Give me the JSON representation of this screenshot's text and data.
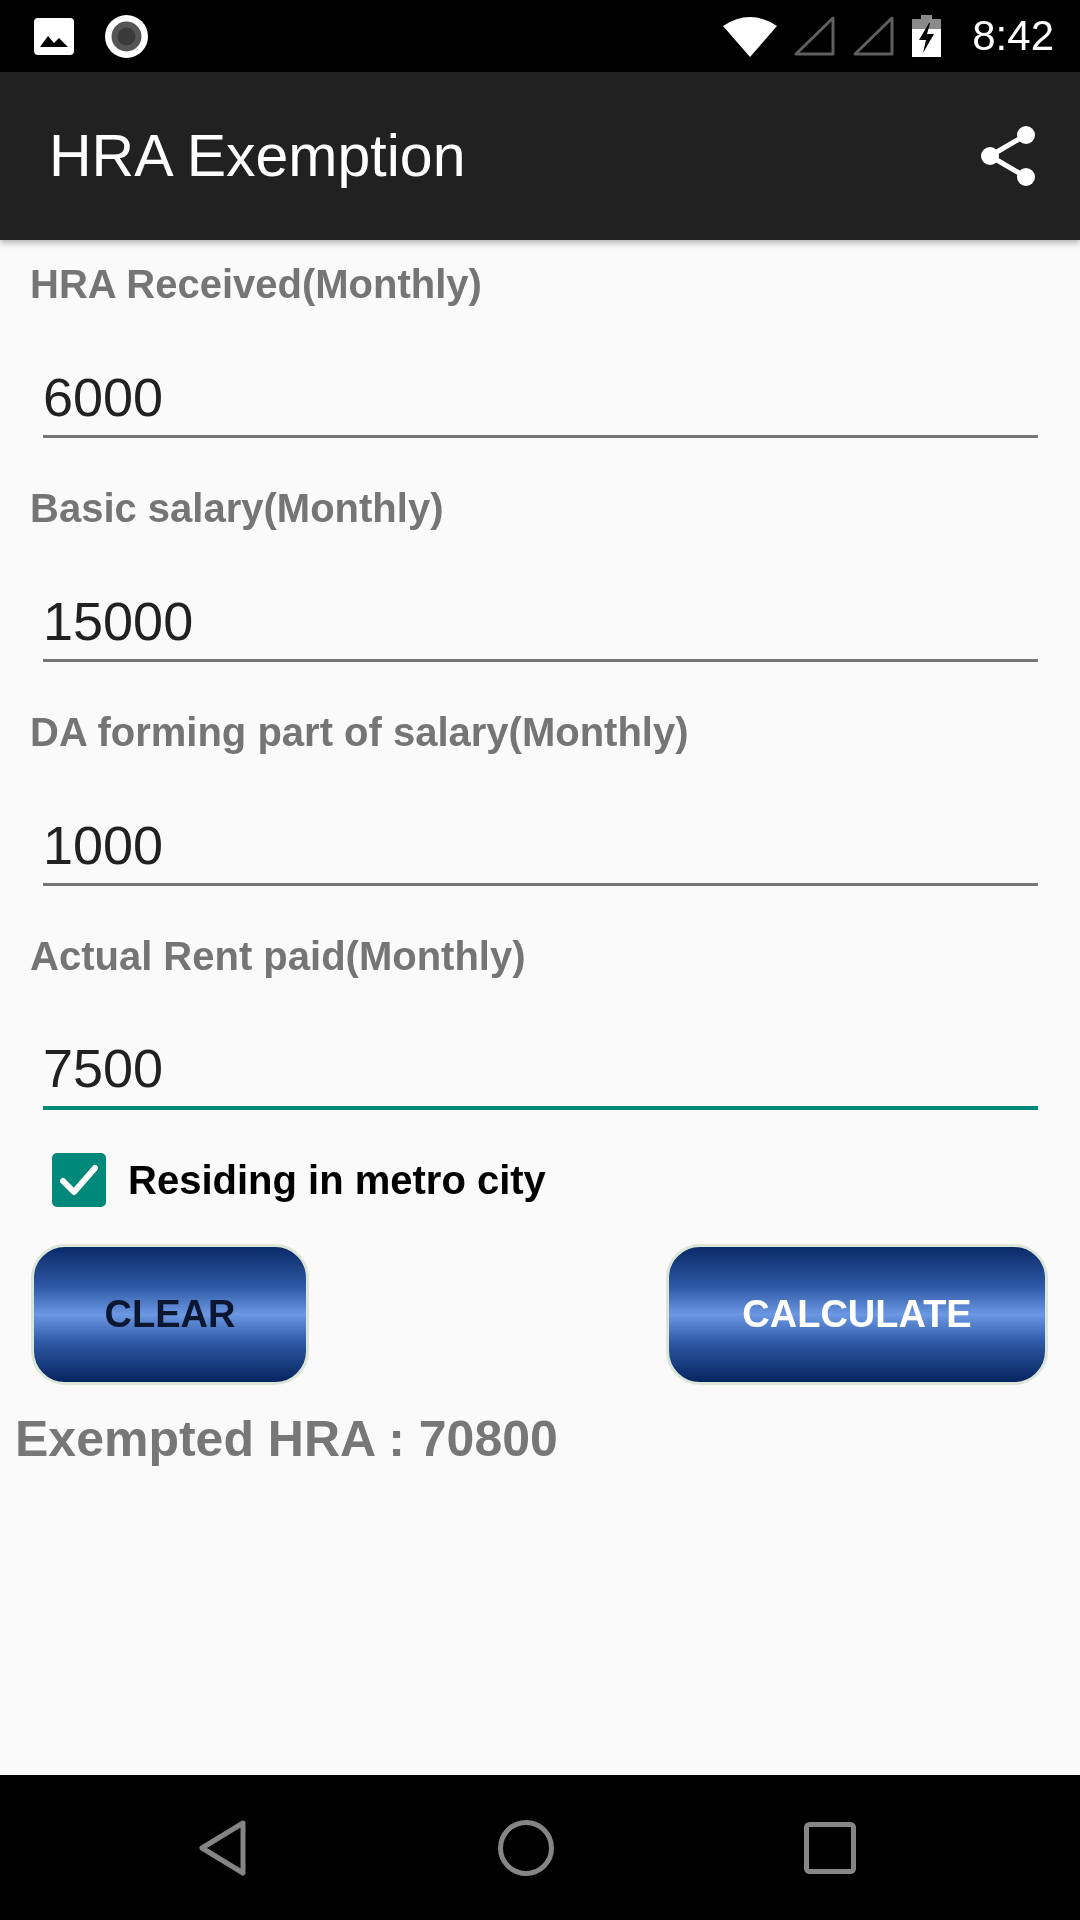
{
  "status_bar": {
    "time": "8:42"
  },
  "app_bar": {
    "title": "HRA Exemption"
  },
  "fields": [
    {
      "label": "HRA Received(Monthly)",
      "value": "6000",
      "focused": false
    },
    {
      "label": "Basic salary(Monthly)",
      "value": "15000",
      "focused": false
    },
    {
      "label": "DA forming part of salary(Monthly)",
      "value": "1000",
      "focused": false
    },
    {
      "label": "Actual Rent paid(Monthly)",
      "value": "7500",
      "focused": true
    }
  ],
  "metro_checkbox": {
    "label": "Residing in metro city",
    "checked": true
  },
  "buttons": [
    {
      "label": "CLEAR",
      "kind": "reset"
    },
    {
      "label": "CALCULATE",
      "kind": "submit"
    }
  ],
  "result": "Exempted HRA : 70800"
}
